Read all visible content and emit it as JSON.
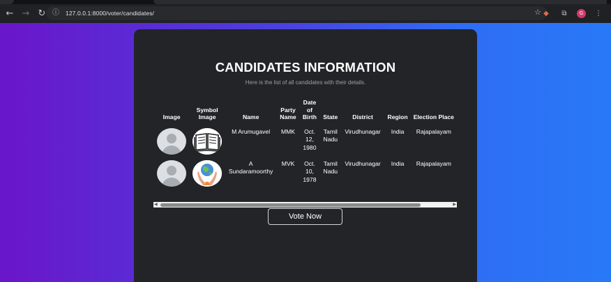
{
  "browser": {
    "url": "127.0.0.1:8000/voter/candidates/",
    "profile_initial": "G"
  },
  "page": {
    "title": "CANDIDATES INFORMATION",
    "subtitle": "Here is the list of all candidates with their details.",
    "vote_button": "Vote Now"
  },
  "table": {
    "headers": {
      "image": "Image",
      "symbol": "Symbol Image",
      "name": "Name",
      "party": "Party Name",
      "dob": "Date of Birth",
      "state": "State",
      "district": "District",
      "region": "Region",
      "place": "Election Place"
    },
    "rows": [
      {
        "name": "M Arumugavel",
        "party": "MMK",
        "dob": "Oct. 12, 1980",
        "state": "Tamil Nadu",
        "district": "Virudhunagar",
        "region": "India",
        "place": "Rajapalayam",
        "symbol_icon": "book-icon"
      },
      {
        "name": "A Sundaramoorthy",
        "party": "MVK",
        "dob": "Oct. 10, 1978",
        "state": "Tamil Nadu",
        "district": "Virudhunagar",
        "region": "India",
        "place": "Rajapalayam",
        "symbol_icon": "globe-in-hands-icon"
      }
    ]
  },
  "colors": {
    "gradient_start": "#6a16c9",
    "gradient_end": "#2879f7",
    "card_bg": "#222428"
  }
}
